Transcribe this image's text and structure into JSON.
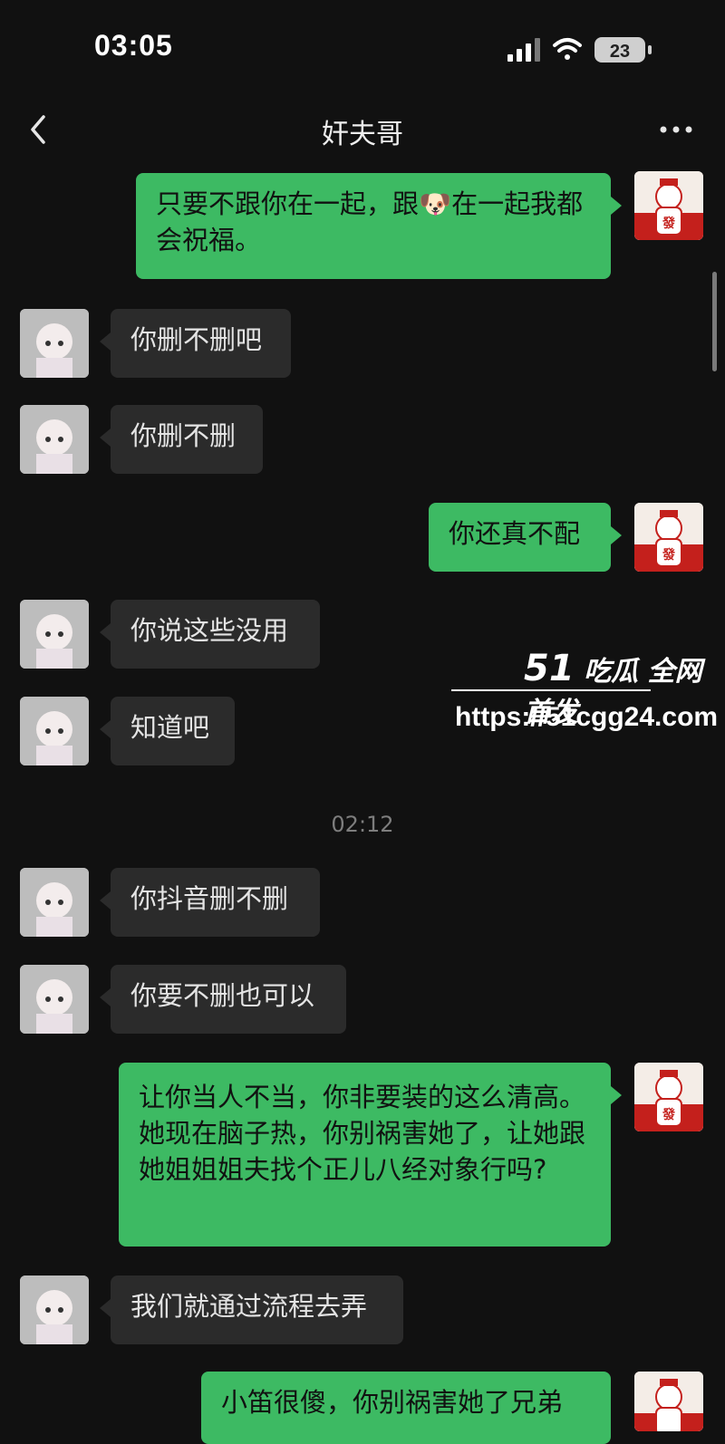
{
  "status": {
    "time": "03:05",
    "battery": "23"
  },
  "header": {
    "title": "奸夫哥"
  },
  "messages": [
    {
      "side": "right",
      "text": "只要不跟你在一起，跟🐶在一起我都会祝福。"
    },
    {
      "side": "left",
      "text": "你删不删吧"
    },
    {
      "side": "left",
      "text": "你删不删"
    },
    {
      "side": "right",
      "text": "你还真不配"
    },
    {
      "side": "left",
      "text": "你说这些没用"
    },
    {
      "side": "left",
      "text": "知道吧"
    },
    {
      "timestamp": "02:12"
    },
    {
      "side": "left",
      "text": "你抖音删不删"
    },
    {
      "side": "left",
      "text": "你要不删也可以"
    },
    {
      "side": "right",
      "text": "让你当人不当，你非要装的这么清高。她现在脑子热，你别祸害她了，让她跟她姐姐姐夫找个正儿八经对象行吗?"
    },
    {
      "side": "left",
      "text": "我们就通过流程去弄"
    },
    {
      "side": "right",
      "text": "小笛很傻，你别祸害她了兄弟"
    }
  ],
  "watermark": {
    "brand_num": "51",
    "brand_text": "吃瓜 全网首发",
    "url": "https://51cgg24.com"
  },
  "colors": {
    "bg": "#111111",
    "me_bubble": "#3dba63",
    "other_bubble": "#2b2b2b"
  },
  "icons": [
    "back-chevron-icon",
    "more-dots-icon",
    "signal-icon",
    "wifi-icon",
    "battery-icon"
  ]
}
